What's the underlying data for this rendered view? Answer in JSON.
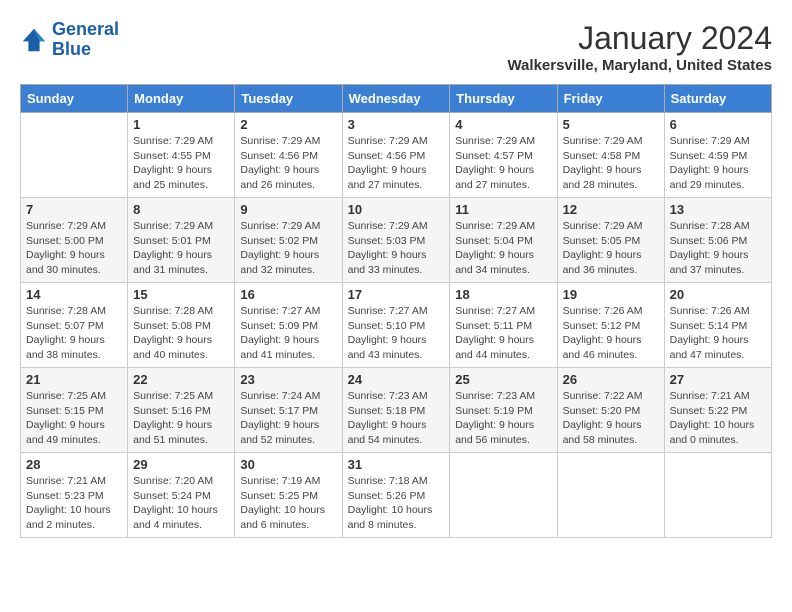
{
  "logo": {
    "text_general": "General",
    "text_blue": "Blue"
  },
  "header": {
    "month": "January 2024",
    "location": "Walkersville, Maryland, United States"
  },
  "days_of_week": [
    "Sunday",
    "Monday",
    "Tuesday",
    "Wednesday",
    "Thursday",
    "Friday",
    "Saturday"
  ],
  "weeks": [
    [
      {
        "day": "",
        "info": ""
      },
      {
        "day": "1",
        "info": "Sunrise: 7:29 AM\nSunset: 4:55 PM\nDaylight: 9 hours\nand 25 minutes."
      },
      {
        "day": "2",
        "info": "Sunrise: 7:29 AM\nSunset: 4:56 PM\nDaylight: 9 hours\nand 26 minutes."
      },
      {
        "day": "3",
        "info": "Sunrise: 7:29 AM\nSunset: 4:56 PM\nDaylight: 9 hours\nand 27 minutes."
      },
      {
        "day": "4",
        "info": "Sunrise: 7:29 AM\nSunset: 4:57 PM\nDaylight: 9 hours\nand 27 minutes."
      },
      {
        "day": "5",
        "info": "Sunrise: 7:29 AM\nSunset: 4:58 PM\nDaylight: 9 hours\nand 28 minutes."
      },
      {
        "day": "6",
        "info": "Sunrise: 7:29 AM\nSunset: 4:59 PM\nDaylight: 9 hours\nand 29 minutes."
      }
    ],
    [
      {
        "day": "7",
        "info": "Sunrise: 7:29 AM\nSunset: 5:00 PM\nDaylight: 9 hours\nand 30 minutes."
      },
      {
        "day": "8",
        "info": "Sunrise: 7:29 AM\nSunset: 5:01 PM\nDaylight: 9 hours\nand 31 minutes."
      },
      {
        "day": "9",
        "info": "Sunrise: 7:29 AM\nSunset: 5:02 PM\nDaylight: 9 hours\nand 32 minutes."
      },
      {
        "day": "10",
        "info": "Sunrise: 7:29 AM\nSunset: 5:03 PM\nDaylight: 9 hours\nand 33 minutes."
      },
      {
        "day": "11",
        "info": "Sunrise: 7:29 AM\nSunset: 5:04 PM\nDaylight: 9 hours\nand 34 minutes."
      },
      {
        "day": "12",
        "info": "Sunrise: 7:29 AM\nSunset: 5:05 PM\nDaylight: 9 hours\nand 36 minutes."
      },
      {
        "day": "13",
        "info": "Sunrise: 7:28 AM\nSunset: 5:06 PM\nDaylight: 9 hours\nand 37 minutes."
      }
    ],
    [
      {
        "day": "14",
        "info": "Sunrise: 7:28 AM\nSunset: 5:07 PM\nDaylight: 9 hours\nand 38 minutes."
      },
      {
        "day": "15",
        "info": "Sunrise: 7:28 AM\nSunset: 5:08 PM\nDaylight: 9 hours\nand 40 minutes."
      },
      {
        "day": "16",
        "info": "Sunrise: 7:27 AM\nSunset: 5:09 PM\nDaylight: 9 hours\nand 41 minutes."
      },
      {
        "day": "17",
        "info": "Sunrise: 7:27 AM\nSunset: 5:10 PM\nDaylight: 9 hours\nand 43 minutes."
      },
      {
        "day": "18",
        "info": "Sunrise: 7:27 AM\nSunset: 5:11 PM\nDaylight: 9 hours\nand 44 minutes."
      },
      {
        "day": "19",
        "info": "Sunrise: 7:26 AM\nSunset: 5:12 PM\nDaylight: 9 hours\nand 46 minutes."
      },
      {
        "day": "20",
        "info": "Sunrise: 7:26 AM\nSunset: 5:14 PM\nDaylight: 9 hours\nand 47 minutes."
      }
    ],
    [
      {
        "day": "21",
        "info": "Sunrise: 7:25 AM\nSunset: 5:15 PM\nDaylight: 9 hours\nand 49 minutes."
      },
      {
        "day": "22",
        "info": "Sunrise: 7:25 AM\nSunset: 5:16 PM\nDaylight: 9 hours\nand 51 minutes."
      },
      {
        "day": "23",
        "info": "Sunrise: 7:24 AM\nSunset: 5:17 PM\nDaylight: 9 hours\nand 52 minutes."
      },
      {
        "day": "24",
        "info": "Sunrise: 7:23 AM\nSunset: 5:18 PM\nDaylight: 9 hours\nand 54 minutes."
      },
      {
        "day": "25",
        "info": "Sunrise: 7:23 AM\nSunset: 5:19 PM\nDaylight: 9 hours\nand 56 minutes."
      },
      {
        "day": "26",
        "info": "Sunrise: 7:22 AM\nSunset: 5:20 PM\nDaylight: 9 hours\nand 58 minutes."
      },
      {
        "day": "27",
        "info": "Sunrise: 7:21 AM\nSunset: 5:22 PM\nDaylight: 10 hours\nand 0 minutes."
      }
    ],
    [
      {
        "day": "28",
        "info": "Sunrise: 7:21 AM\nSunset: 5:23 PM\nDaylight: 10 hours\nand 2 minutes."
      },
      {
        "day": "29",
        "info": "Sunrise: 7:20 AM\nSunset: 5:24 PM\nDaylight: 10 hours\nand 4 minutes."
      },
      {
        "day": "30",
        "info": "Sunrise: 7:19 AM\nSunset: 5:25 PM\nDaylight: 10 hours\nand 6 minutes."
      },
      {
        "day": "31",
        "info": "Sunrise: 7:18 AM\nSunset: 5:26 PM\nDaylight: 10 hours\nand 8 minutes."
      },
      {
        "day": "",
        "info": ""
      },
      {
        "day": "",
        "info": ""
      },
      {
        "day": "",
        "info": ""
      }
    ]
  ]
}
